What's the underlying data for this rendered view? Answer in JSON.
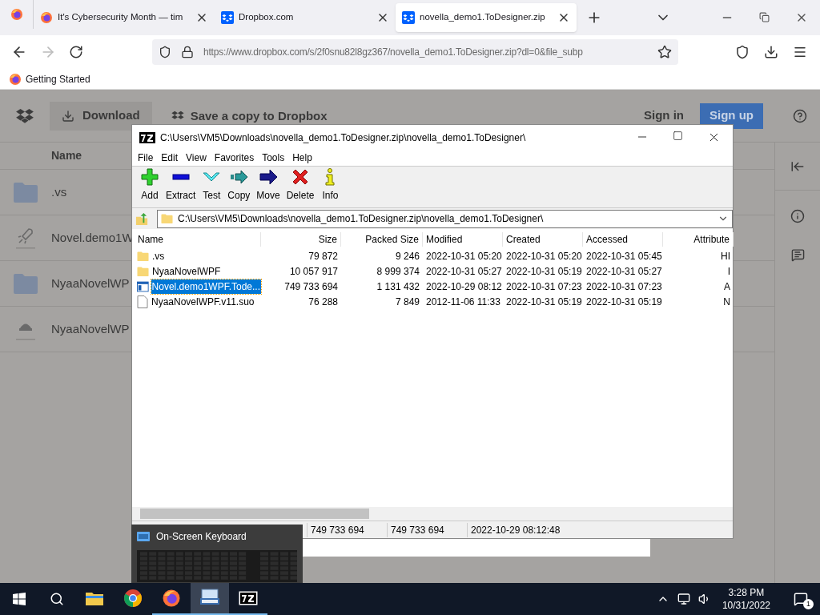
{
  "browser": {
    "tabs": [
      {
        "kind": "pinned",
        "selected": false
      },
      {
        "kind": "firefox",
        "label": "It's Cybersecurity Month — tim",
        "selected": false
      },
      {
        "kind": "dropbox",
        "label": "Dropbox.com",
        "selected": false
      },
      {
        "kind": "dropbox",
        "label": "novella_demo1.ToDesigner.zip",
        "selected": true
      }
    ],
    "url": "https://www.dropbox.com/s/2f0snu82l8gz367/novella_demo1.ToDesigner.zip?dl=0&file_subp",
    "bookmarks": [
      "Getting Started"
    ]
  },
  "dropbox": {
    "download": "Download",
    "save_copy": "Save a copy to Dropbox",
    "sign_in": "Sign in",
    "sign_up": "Sign up",
    "name_header": "Name",
    "items": [
      {
        "kind": "folder",
        "name": ".vs"
      },
      {
        "kind": "rocket",
        "name": "Novel.demo1W"
      },
      {
        "kind": "folder",
        "name": "NyaaNovelWP"
      },
      {
        "kind": "app",
        "name": "NyaaNovelWP"
      }
    ]
  },
  "sevenzip": {
    "title": "C:\\Users\\VM5\\Downloads\\novella_demo1.ToDesigner.zip\\novella_demo1.ToDesigner\\",
    "menu": [
      "File",
      "Edit",
      "View",
      "Favorites",
      "Tools",
      "Help"
    ],
    "toolbar": [
      {
        "kind": "add",
        "label": "Add"
      },
      {
        "kind": "extract",
        "label": "Extract"
      },
      {
        "kind": "test",
        "label": "Test"
      },
      {
        "kind": "copy",
        "label": "Copy"
      },
      {
        "kind": "move",
        "label": "Move"
      },
      {
        "kind": "delete",
        "label": "Delete"
      },
      {
        "kind": "info",
        "label": "Info"
      }
    ],
    "path": "C:\\Users\\VM5\\Downloads\\novella_demo1.ToDesigner.zip\\novella_demo1.ToDesigner\\",
    "columns": [
      "Name",
      "Size",
      "Packed Size",
      "Modified",
      "Created",
      "Accessed",
      "Attribute"
    ],
    "rows": [
      {
        "kind": "folder",
        "selected": false,
        "cells": [
          ".vs",
          "79 872",
          "9 246",
          "2022-10-31 05:20",
          "2022-10-31 05:20",
          "2022-10-31 05:45",
          "HI"
        ]
      },
      {
        "kind": "folder",
        "selected": false,
        "cells": [
          "NyaaNovelWPF",
          "10 057 917",
          "8 999 374",
          "2022-10-31 05:27",
          "2022-10-31 05:19",
          "2022-10-31 05:27",
          "I"
        ]
      },
      {
        "kind": "exe",
        "selected": true,
        "cells": [
          "Novel.demo1WPF.Tode...",
          "749 733 694",
          "1 131 432",
          "2022-10-29 08:12",
          "2022-10-31 07:23",
          "2022-10-31 07:23",
          "A"
        ]
      },
      {
        "kind": "file",
        "selected": false,
        "cells": [
          "NyaaNovelWPF.v11.suo",
          "76 288",
          "7 849",
          "2012-11-06 11:33",
          "2022-10-31 05:19",
          "2022-10-31 05:19",
          "N"
        ]
      }
    ],
    "status": [
      "749 733 694",
      "749 733 694",
      "2022-10-29 08:12:48"
    ]
  },
  "preview": {
    "title": "On-Screen Keyboard"
  },
  "taskbar": {
    "apps": [
      {
        "kind": "explorer",
        "running": false,
        "selected": false
      },
      {
        "kind": "chrome",
        "running": false,
        "selected": false
      },
      {
        "kind": "firefox",
        "running": true,
        "selected": false
      },
      {
        "kind": "osk",
        "running": true,
        "selected": true
      },
      {
        "kind": "sevenzip",
        "running": true,
        "selected": false
      }
    ],
    "time": "3:28 PM",
    "date": "10/31/2022",
    "notifications": "1"
  }
}
